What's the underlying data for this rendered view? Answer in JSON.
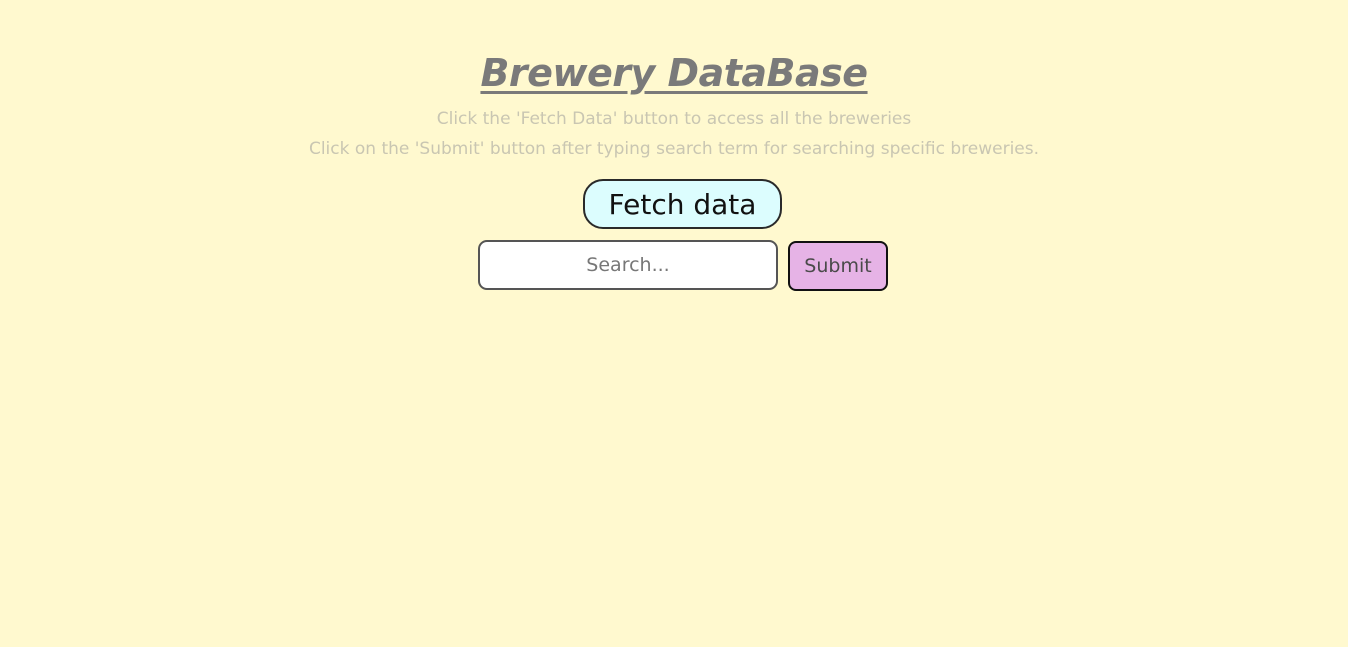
{
  "header": {
    "title": "Brewery DataBase",
    "hint_fetch": "Click the 'Fetch Data' button to access all the breweries",
    "hint_submit": "Click on the 'Submit' button after typing search term for searching specific breweries."
  },
  "controls": {
    "fetch_label": "Fetch data",
    "search_placeholder": "Search...",
    "search_value": "",
    "submit_label": "Submit"
  },
  "colors": {
    "background": "#fff9cf",
    "fetch_button": "#dcfdfe",
    "submit_button": "#e6b3e6",
    "title": "#7a7a7a"
  }
}
